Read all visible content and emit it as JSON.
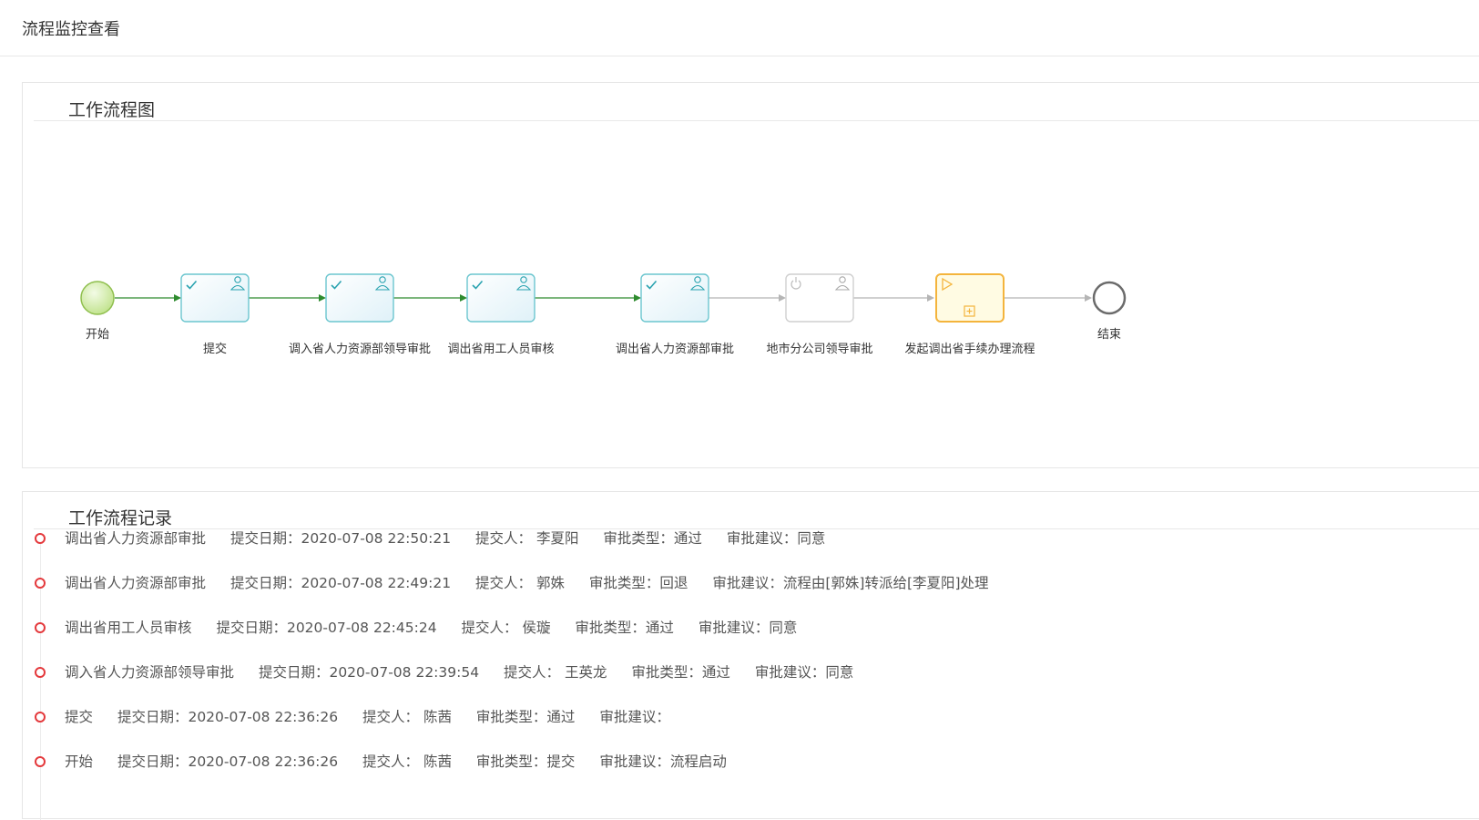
{
  "page": {
    "title": "流程监控查看"
  },
  "diagram": {
    "title": "工作流程图",
    "nodes": [
      {
        "label": "开始",
        "kind": "start-event",
        "status": "completed"
      },
      {
        "label": "提交",
        "kind": "user-task",
        "status": "completed"
      },
      {
        "label": "调入省人力资源部领导审批",
        "kind": "user-task",
        "status": "completed"
      },
      {
        "label": "调出省用工人员审核",
        "kind": "user-task",
        "status": "completed"
      },
      {
        "label": "调出省人力资源部审批",
        "kind": "user-task",
        "status": "completed"
      },
      {
        "label": "地市分公司领导审批",
        "kind": "user-task",
        "status": "pending"
      },
      {
        "label": "发起调出省手续办理流程",
        "kind": "sub-process",
        "status": "active"
      },
      {
        "label": "结束",
        "kind": "end-event",
        "status": "pending"
      }
    ],
    "colors": {
      "completed_edge": "#2e8b2e",
      "pending_edge": "#b5b5b5",
      "completed_task_border": "#6cc6cf",
      "pending_task_border": "#cfcfcf",
      "active_task_border": "#f4b43c",
      "active_task_fill": "#fffbe3",
      "start_fill": "#c9ea9a"
    }
  },
  "records": {
    "title": "工作流程记录",
    "items": [
      {
        "step": "调出省人力资源部审批",
        "date": "提交日期：2020-07-08 22:50:21",
        "submitter": "提交人： 李夏阳",
        "type": "审批类型：通过",
        "opinion": "审批建议：同意"
      },
      {
        "step": "调出省人力资源部审批",
        "date": "提交日期：2020-07-08 22:49:21",
        "submitter": "提交人： 郭姝",
        "type": "审批类型：回退",
        "opinion": "审批建议：流程由[郭姝]转派给[李夏阳]处理"
      },
      {
        "step": "调出省用工人员审核",
        "date": "提交日期：2020-07-08 22:45:24",
        "submitter": "提交人： 侯璇",
        "type": "审批类型：通过",
        "opinion": "审批建议：同意"
      },
      {
        "step": "调入省人力资源部领导审批",
        "date": "提交日期：2020-07-08 22:39:54",
        "submitter": "提交人： 王英龙",
        "type": "审批类型：通过",
        "opinion": "审批建议：同意"
      },
      {
        "step": "提交",
        "date": "提交日期：2020-07-08 22:36:26",
        "submitter": "提交人： 陈茜",
        "type": "审批类型：通过",
        "opinion": "审批建议："
      },
      {
        "step": "开始",
        "date": "提交日期：2020-07-08 22:36:26",
        "submitter": "提交人： 陈茜",
        "type": "审批类型：提交",
        "opinion": "审批建议：流程启动"
      }
    ],
    "dot_color": "#e4393c"
  }
}
